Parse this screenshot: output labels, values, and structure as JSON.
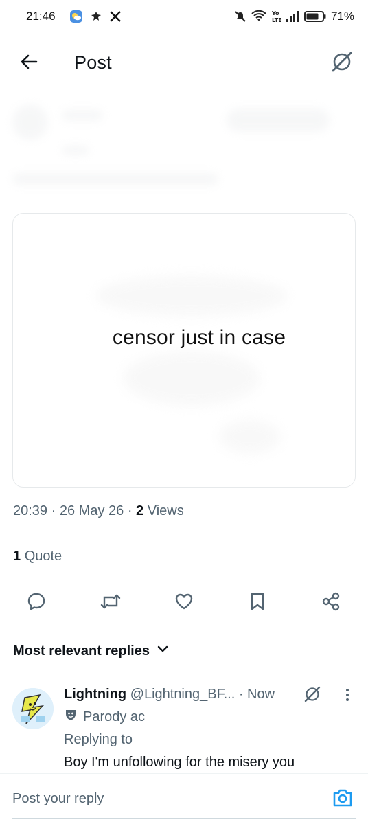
{
  "status_bar": {
    "time": "21:46",
    "battery": "71%",
    "left_icons": [
      "weather-icon",
      "notification-icon",
      "x-icon"
    ],
    "right_icons": [
      "mute-icon",
      "wifi-icon",
      "volte-icon",
      "signal-icon",
      "battery-icon"
    ]
  },
  "header": {
    "back_icon": "arrow-left-icon",
    "title": "Post",
    "grok_icon": "grok-icon"
  },
  "media": {
    "caption_text": "censor just in case"
  },
  "meta": {
    "time": "20:39",
    "separator": "·",
    "date": "26 May 26",
    "views_count": "2",
    "views_label": "Views"
  },
  "quotes": {
    "count": "1",
    "label": "Quote"
  },
  "actions": [
    "reply-icon",
    "repost-icon",
    "like-icon",
    "bookmark-icon",
    "share-icon"
  ],
  "replies": {
    "heading": "Most relevant replies",
    "items": [
      {
        "name": "Lightning",
        "handle": "@Lightning_BF...",
        "time": "· Now",
        "badge": "Parody ac",
        "replying_to": "Replying to",
        "text": "Boy I'm unfollowing for the misery you"
      }
    ]
  },
  "compose": {
    "placeholder": "Post your reply"
  },
  "colors": {
    "text": "#0f1419",
    "secondary": "#536471",
    "accent": "#1d9bf0",
    "divider": "#eff3f4"
  }
}
